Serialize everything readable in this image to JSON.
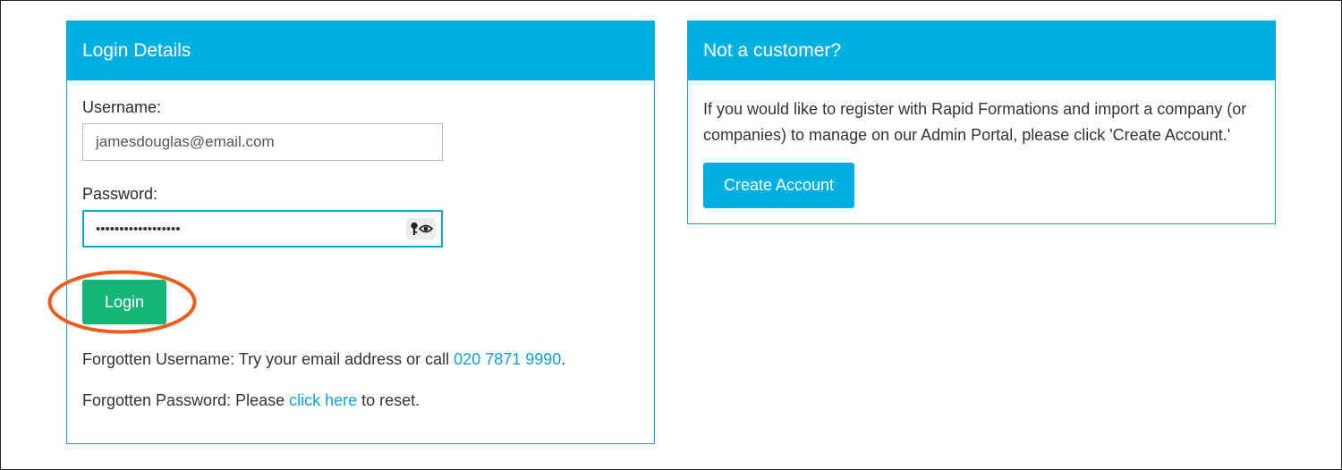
{
  "login_panel": {
    "title": "Login Details",
    "username_label": "Username:",
    "username_value": "jamesdouglas@email.com",
    "password_label": "Password:",
    "password_mask": "••••••••••••••••••",
    "login_button": "Login",
    "forgot_username_prefix": "Forgotten Username: Try your email address or call ",
    "forgot_username_phone": "020 7871 9990",
    "forgot_username_suffix": ".",
    "forgot_password_prefix": "Forgotten Password: Please ",
    "forgot_password_link": "click here",
    "forgot_password_suffix": " to reset."
  },
  "register_panel": {
    "title": "Not a customer?",
    "description": "If you would like to register with Rapid Formations and import a company (or companies) to manage on our Admin Portal, please click 'Create Account.'",
    "create_button": "Create Account"
  },
  "icons": {
    "password_manager": "key-icon",
    "show_password": "eye-icon"
  },
  "colors": {
    "header": "#00b0e2",
    "border": "#0fa9d6",
    "login_button": "#14b577",
    "create_button": "#00b0e2",
    "link": "#10a3d6",
    "annotation": "#f05a1a"
  }
}
